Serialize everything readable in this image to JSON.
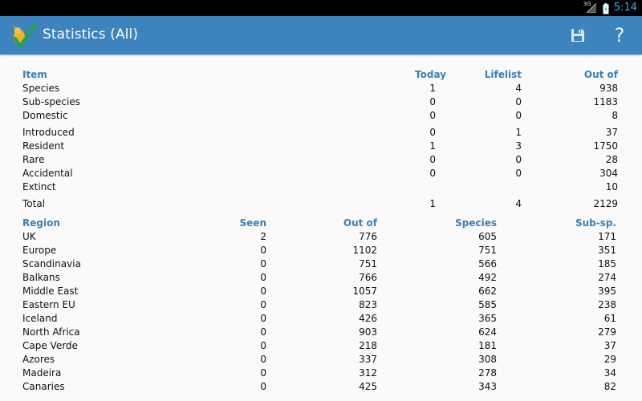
{
  "status_bar": {
    "network": "3G",
    "time": "5:14"
  },
  "app": {
    "title": "Statistics (All)"
  },
  "actions": {
    "save_icon": "save-icon",
    "help_label": "?"
  },
  "items_table": {
    "headers": [
      "Item",
      "Today",
      "Lifelist",
      "Out of"
    ],
    "rows": [
      {
        "item": "Species",
        "today": "1",
        "lifelist": "4",
        "out_of": "938"
      },
      {
        "item": "Sub-species",
        "today": "0",
        "lifelist": "0",
        "out_of": "1183"
      },
      {
        "item": "Domestic",
        "today": "0",
        "lifelist": "0",
        "out_of": "8"
      },
      {
        "item": "Introduced",
        "today": "0",
        "lifelist": "1",
        "out_of": "37"
      },
      {
        "item": "Resident",
        "today": "1",
        "lifelist": "3",
        "out_of": "1750"
      },
      {
        "item": "Rare",
        "today": "0",
        "lifelist": "0",
        "out_of": "28"
      },
      {
        "item": "Accidental",
        "today": "0",
        "lifelist": "0",
        "out_of": "304"
      },
      {
        "item": "Extinct",
        "today": "",
        "lifelist": "",
        "out_of": "10"
      }
    ],
    "total": {
      "item": "Total",
      "today": "1",
      "lifelist": "4",
      "out_of": "2129"
    }
  },
  "regions_table": {
    "headers": [
      "Region",
      "Seen",
      "Out of",
      "Species",
      "Sub-sp."
    ],
    "rows": [
      {
        "region": "UK",
        "seen": "2",
        "out_of": "776",
        "species": "605",
        "subsp": "171"
      },
      {
        "region": "Europe",
        "seen": "0",
        "out_of": "1102",
        "species": "751",
        "subsp": "351"
      },
      {
        "region": "Scandinavia",
        "seen": "0",
        "out_of": "751",
        "species": "566",
        "subsp": "185"
      },
      {
        "region": "Balkans",
        "seen": "0",
        "out_of": "766",
        "species": "492",
        "subsp": "274"
      },
      {
        "region": "Middle East",
        "seen": "0",
        "out_of": "1057",
        "species": "662",
        "subsp": "395"
      },
      {
        "region": "Eastern EU",
        "seen": "0",
        "out_of": "823",
        "species": "585",
        "subsp": "238"
      },
      {
        "region": "Iceland",
        "seen": "0",
        "out_of": "426",
        "species": "365",
        "subsp": "61"
      },
      {
        "region": "North Africa",
        "seen": "0",
        "out_of": "903",
        "species": "624",
        "subsp": "279"
      },
      {
        "region": "Cape Verde",
        "seen": "0",
        "out_of": "218",
        "species": "181",
        "subsp": "37"
      },
      {
        "region": "Azores",
        "seen": "0",
        "out_of": "337",
        "species": "308",
        "subsp": "29"
      },
      {
        "region": "Madeira",
        "seen": "0",
        "out_of": "312",
        "species": "278",
        "subsp": "34"
      },
      {
        "region": "Canaries",
        "seen": "0",
        "out_of": "425",
        "species": "343",
        "subsp": "82"
      }
    ]
  },
  "colors": {
    "action_bar": "#3d83bd",
    "header_text": "#3a7fb8",
    "status_accent": "#33b5e5"
  }
}
